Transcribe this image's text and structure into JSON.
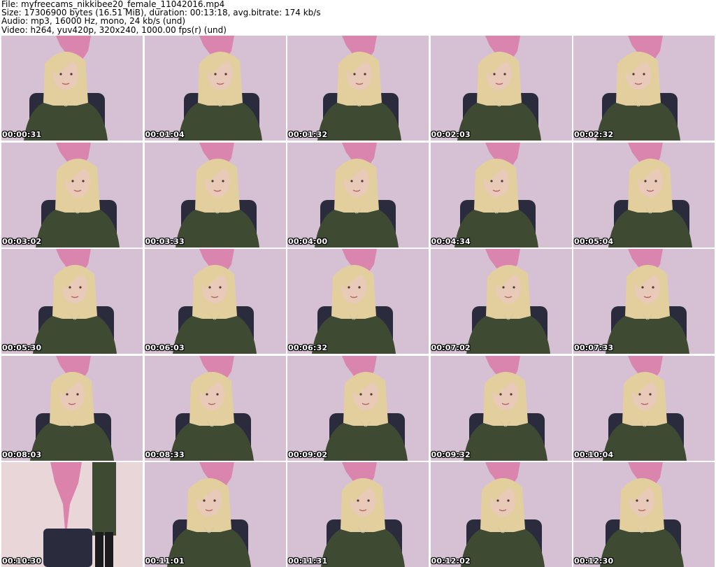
{
  "header": {
    "file": "File: myfreecams_nikkibee20_female_11042016.mp4",
    "size": "Size: 17306900 bytes (16.51 MiB), duration: 00:13:18, avg.bitrate: 174 kb/s",
    "audio": "Audio: mp3, 16000 Hz, mono, 24 kb/s (und)",
    "video": "Video: h264, yuv420p, 320x240, 1000.00 fps(r) (und)"
  },
  "thumbnails": [
    {
      "time": "00:00:31"
    },
    {
      "time": "00:01:04"
    },
    {
      "time": "00:01:32"
    },
    {
      "time": "00:02:03"
    },
    {
      "time": "00:02:32"
    },
    {
      "time": "00:03:02"
    },
    {
      "time": "00:03:33"
    },
    {
      "time": "00:04:00"
    },
    {
      "time": "00:04:34"
    },
    {
      "time": "00:05:04"
    },
    {
      "time": "00:05:30"
    },
    {
      "time": "00:06:03"
    },
    {
      "time": "00:06:32"
    },
    {
      "time": "00:07:02"
    },
    {
      "time": "00:07:33"
    },
    {
      "time": "00:08:03"
    },
    {
      "time": "00:08:33"
    },
    {
      "time": "00:09:02"
    },
    {
      "time": "00:09:32"
    },
    {
      "time": "00:10:04"
    },
    {
      "time": "00:10:30"
    },
    {
      "time": "00:11:01"
    },
    {
      "time": "00:11:31"
    },
    {
      "time": "00:12:02"
    },
    {
      "time": "00:12:30"
    }
  ],
  "colors": {
    "wall": "#d6c0d4",
    "art": "#d97aa6",
    "hair": "#e3cf9d",
    "skin": "#e9c9b8",
    "sweater": "#3f4a33",
    "chair": "#2a2c3e"
  }
}
